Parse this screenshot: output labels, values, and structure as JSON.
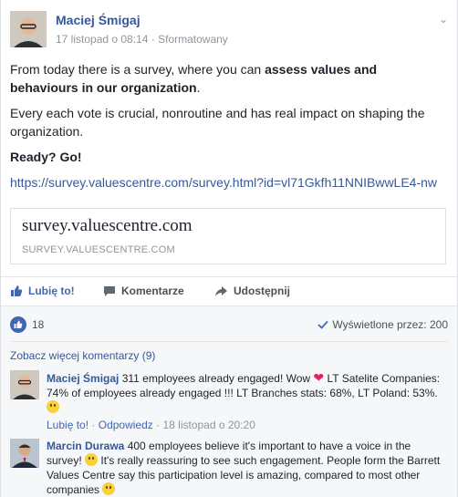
{
  "post": {
    "author": "Maciej Śmigaj",
    "date": "17 listopad o 08:14",
    "edited": "Sformatowany",
    "dot": "·",
    "chevron": "⌄",
    "p1_a": "From today there is a survey, where you can ",
    "p1_b": "assess values and behaviours in our organization",
    "p1_c": ".",
    "p2": "Every each vote is crucial, nonroutine and has real impact on shaping the organization.",
    "p3": "Ready? Go!",
    "link": "https://survey.valuescentre.com/survey.html?id=vl71Gkfh11NNIBwwLE4-nw"
  },
  "preview": {
    "title": "survey.valuescentre.com",
    "domain": "SURVEY.VALUESCENTRE.COM"
  },
  "actions": {
    "like": "Lubię to!",
    "comment": "Komentarze",
    "share": "Udostępnij"
  },
  "stats": {
    "likes": "18",
    "seen": "Wyświetlone przez: 200"
  },
  "comments": {
    "more": "Zobacz więcej komentarzy (9)",
    "items": [
      {
        "author": "Maciej Śmigaj",
        "text_a": "311 employees already engaged! Wow",
        "text_b": "LT Satelite Companies: 74% of employees already engaged !!! LT Branches stats: 68%, LT Poland: 53%.",
        "like": "Lubię to!",
        "reply": "Odpowiedz",
        "time": "18 listopad o 20:20",
        "sep": "·"
      },
      {
        "author": "Marcin Durawa",
        "text_a": "400 employees believe it's important to have a voice in the survey!",
        "text_b": "It's really reassuring to see such engagement. People form the Barrett Values Centre say this participation level is amazing, compared to most other companies"
      }
    ]
  },
  "colors": {
    "link": "#365899",
    "brand": "#4267b2",
    "muted": "#90949c"
  }
}
